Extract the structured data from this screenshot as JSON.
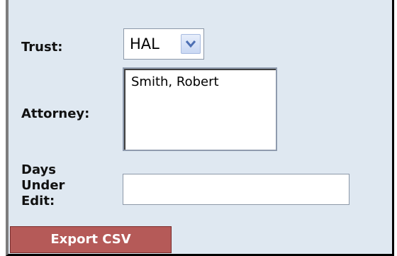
{
  "form": {
    "trust_label": "Trust:",
    "trust_value": "HAL",
    "attorney_label": "Attorney:",
    "attorney_options": [
      "Smith, Robert"
    ],
    "days_label_line1": "Days",
    "days_label_line2": "Under",
    "days_label_line3": "Edit:",
    "days_value": "",
    "export_label": "Export CSV"
  },
  "colors": {
    "panel_background": "#dfe8f1",
    "export_button": "#b55a58"
  }
}
